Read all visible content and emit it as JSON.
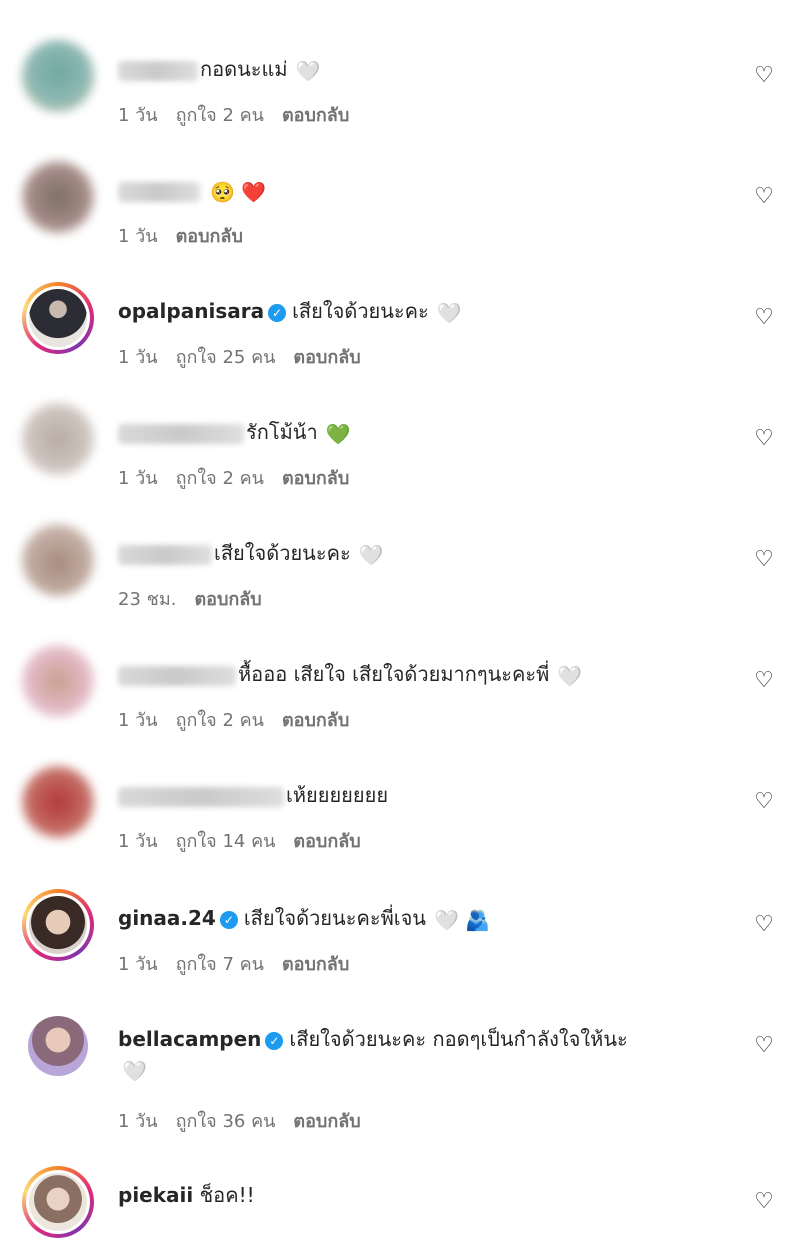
{
  "colors": {
    "verified": "#1d9bf0",
    "meta_text": "#737373",
    "text": "#262626"
  },
  "comments": [
    {
      "text": "กอดนะแม่",
      "emoji": "🤍",
      "time": "1 วัน",
      "likes": "ถูกใจ 2 คน",
      "reply": "ตอบกลับ"
    },
    {
      "text": "",
      "emoji": "🥺 ❤️",
      "time": "1 วัน",
      "reply": "ตอบกลับ"
    },
    {
      "username": "opalpanisara",
      "text": "เสียใจด้วยนะคะ",
      "emoji": "🤍",
      "time": "1 วัน",
      "likes": "ถูกใจ 25 คน",
      "reply": "ตอบกลับ"
    },
    {
      "text": "รักโม้น้า",
      "emoji": "💚",
      "time": "1 วัน",
      "likes": "ถูกใจ 2 คน",
      "reply": "ตอบกลับ"
    },
    {
      "text": "เสียใจด้วยนะคะ",
      "emoji": "🤍",
      "time": "23 ชม.",
      "reply": "ตอบกลับ"
    },
    {
      "text": "หื้อออ เสียใจ เสียใจด้วยมากๆนะคะพี่",
      "emoji": "🤍",
      "time": "1 วัน",
      "likes": "ถูกใจ 2 คน",
      "reply": "ตอบกลับ"
    },
    {
      "text": "เห้ยยยยยยย",
      "time": "1 วัน",
      "likes": "ถูกใจ 14 คน",
      "reply": "ตอบกลับ"
    },
    {
      "username": "ginaa.24",
      "text": "เสียใจด้วยนะคะพี่เจน",
      "emoji": "🤍 🫂",
      "time": "1 วัน",
      "likes": "ถูกใจ 7 คน",
      "reply": "ตอบกลับ"
    },
    {
      "username": "bellacampen",
      "text": "เสียใจด้วยนะคะ กอดๆเป็นกำลังใจให้นะ",
      "emoji": "🤍",
      "time": "1 วัน",
      "likes": "ถูกใจ 36 คน",
      "reply": "ตอบกลับ"
    },
    {
      "username": "piekaii",
      "text": "ช็อค!!"
    }
  ]
}
